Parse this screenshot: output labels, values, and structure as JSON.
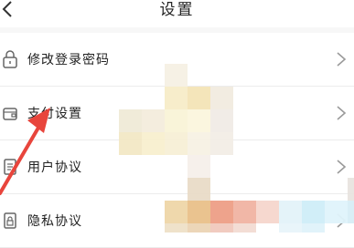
{
  "header": {
    "title": "设置",
    "back_icon": "chevron-left-icon"
  },
  "settings": {
    "items": [
      {
        "label": "修改登录密码",
        "icon": "lock-icon"
      },
      {
        "label": "支付设置",
        "icon": "wallet-icon"
      },
      {
        "label": "用户协议",
        "icon": "document-icon"
      },
      {
        "label": "隐私协议",
        "icon": "privacy-lock-icon"
      }
    ]
  },
  "annotation": {
    "arrow_color": "#e8453c"
  }
}
